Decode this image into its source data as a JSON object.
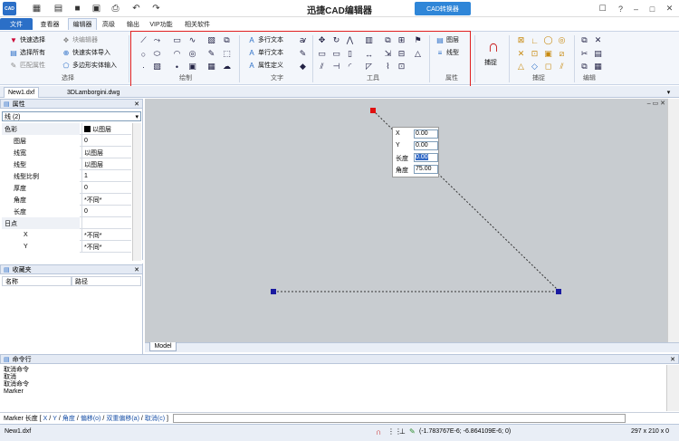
{
  "app": {
    "title": "迅捷CAD编辑器",
    "converter_label": "CAD转换器",
    "logo_text": "CAD"
  },
  "menu": {
    "tabs": [
      "文件",
      "查看器",
      "编辑器",
      "高级",
      "输出",
      "VIP功能",
      "相关软件"
    ]
  },
  "ribbon": {
    "select": {
      "group": "选择",
      "quick_select": "快速选择",
      "select_all": "选择所有",
      "match_props": "匹配属性",
      "block_editor": "块编辑器",
      "quick_entity_import": "快速实体导入",
      "poly_entity_input": "多边形实体输入"
    },
    "draw": {
      "group": "绘制"
    },
    "text": {
      "group": "文字",
      "mtext": "多行文本",
      "stext": "单行文本",
      "attdef": "属性定义"
    },
    "tools": {
      "group": "工具"
    },
    "props": {
      "group": "属性",
      "layer": "图层",
      "linetype": "线型"
    },
    "snap": {
      "group": "捕捉",
      "snap_btn": "捕捉"
    },
    "edit": {
      "group": "编辑"
    }
  },
  "doctabs": [
    "New1.dxf",
    "3DLamborgini.dwg"
  ],
  "properties": {
    "title": "属性",
    "selection": "线 (2)",
    "rows": [
      {
        "k": "色彩",
        "v": "以图层",
        "type": "cat"
      },
      {
        "k": "图层",
        "v": "0"
      },
      {
        "k": "线宽",
        "v": "以图层"
      },
      {
        "k": "线型",
        "v": "以图层"
      },
      {
        "k": "线型比例",
        "v": "1"
      },
      {
        "k": "厚度",
        "v": "0"
      },
      {
        "k": "角度",
        "v": "*不同*"
      },
      {
        "k": "长度",
        "v": "0"
      },
      {
        "k": "日点",
        "v": "",
        "type": "cat"
      },
      {
        "k": "X",
        "v": "*不同*",
        "type": "sub"
      },
      {
        "k": "Y",
        "v": "*不同*",
        "type": "sub"
      }
    ]
  },
  "favorites": {
    "title": "收藏夹",
    "col_name": "名称",
    "col_path": "路径"
  },
  "dynamic_input": {
    "x_label": "X",
    "x_value": "0.00",
    "y_label": "Y",
    "y_value": "0.00",
    "len_label": "长度",
    "len_value": "0.00",
    "ang_label": "角度",
    "ang_value": "75.00"
  },
  "canvas": {
    "model_tab": "Model"
  },
  "command": {
    "title": "命令行",
    "history": [
      "取消命令",
      "取消",
      "取消命令",
      "Marker"
    ],
    "prompt_prefix": "Marker 长度 [",
    "options": [
      "X",
      "Y",
      "角度",
      "偏移(o)",
      "双重偏移(a)",
      "取消(c)"
    ],
    "prompt_suffix": "]"
  },
  "status": {
    "file": "New1.dxf",
    "coords": "(-1.783767E-6; -6.864109E-6; 0)",
    "paper": "297 x 210 x 0"
  },
  "colors": {
    "accent": "#2b6fc7",
    "highlight": "#e02020",
    "canvas": "#c8ccd0",
    "grip": "#1a1aa0",
    "grip_active": "#e01010"
  }
}
